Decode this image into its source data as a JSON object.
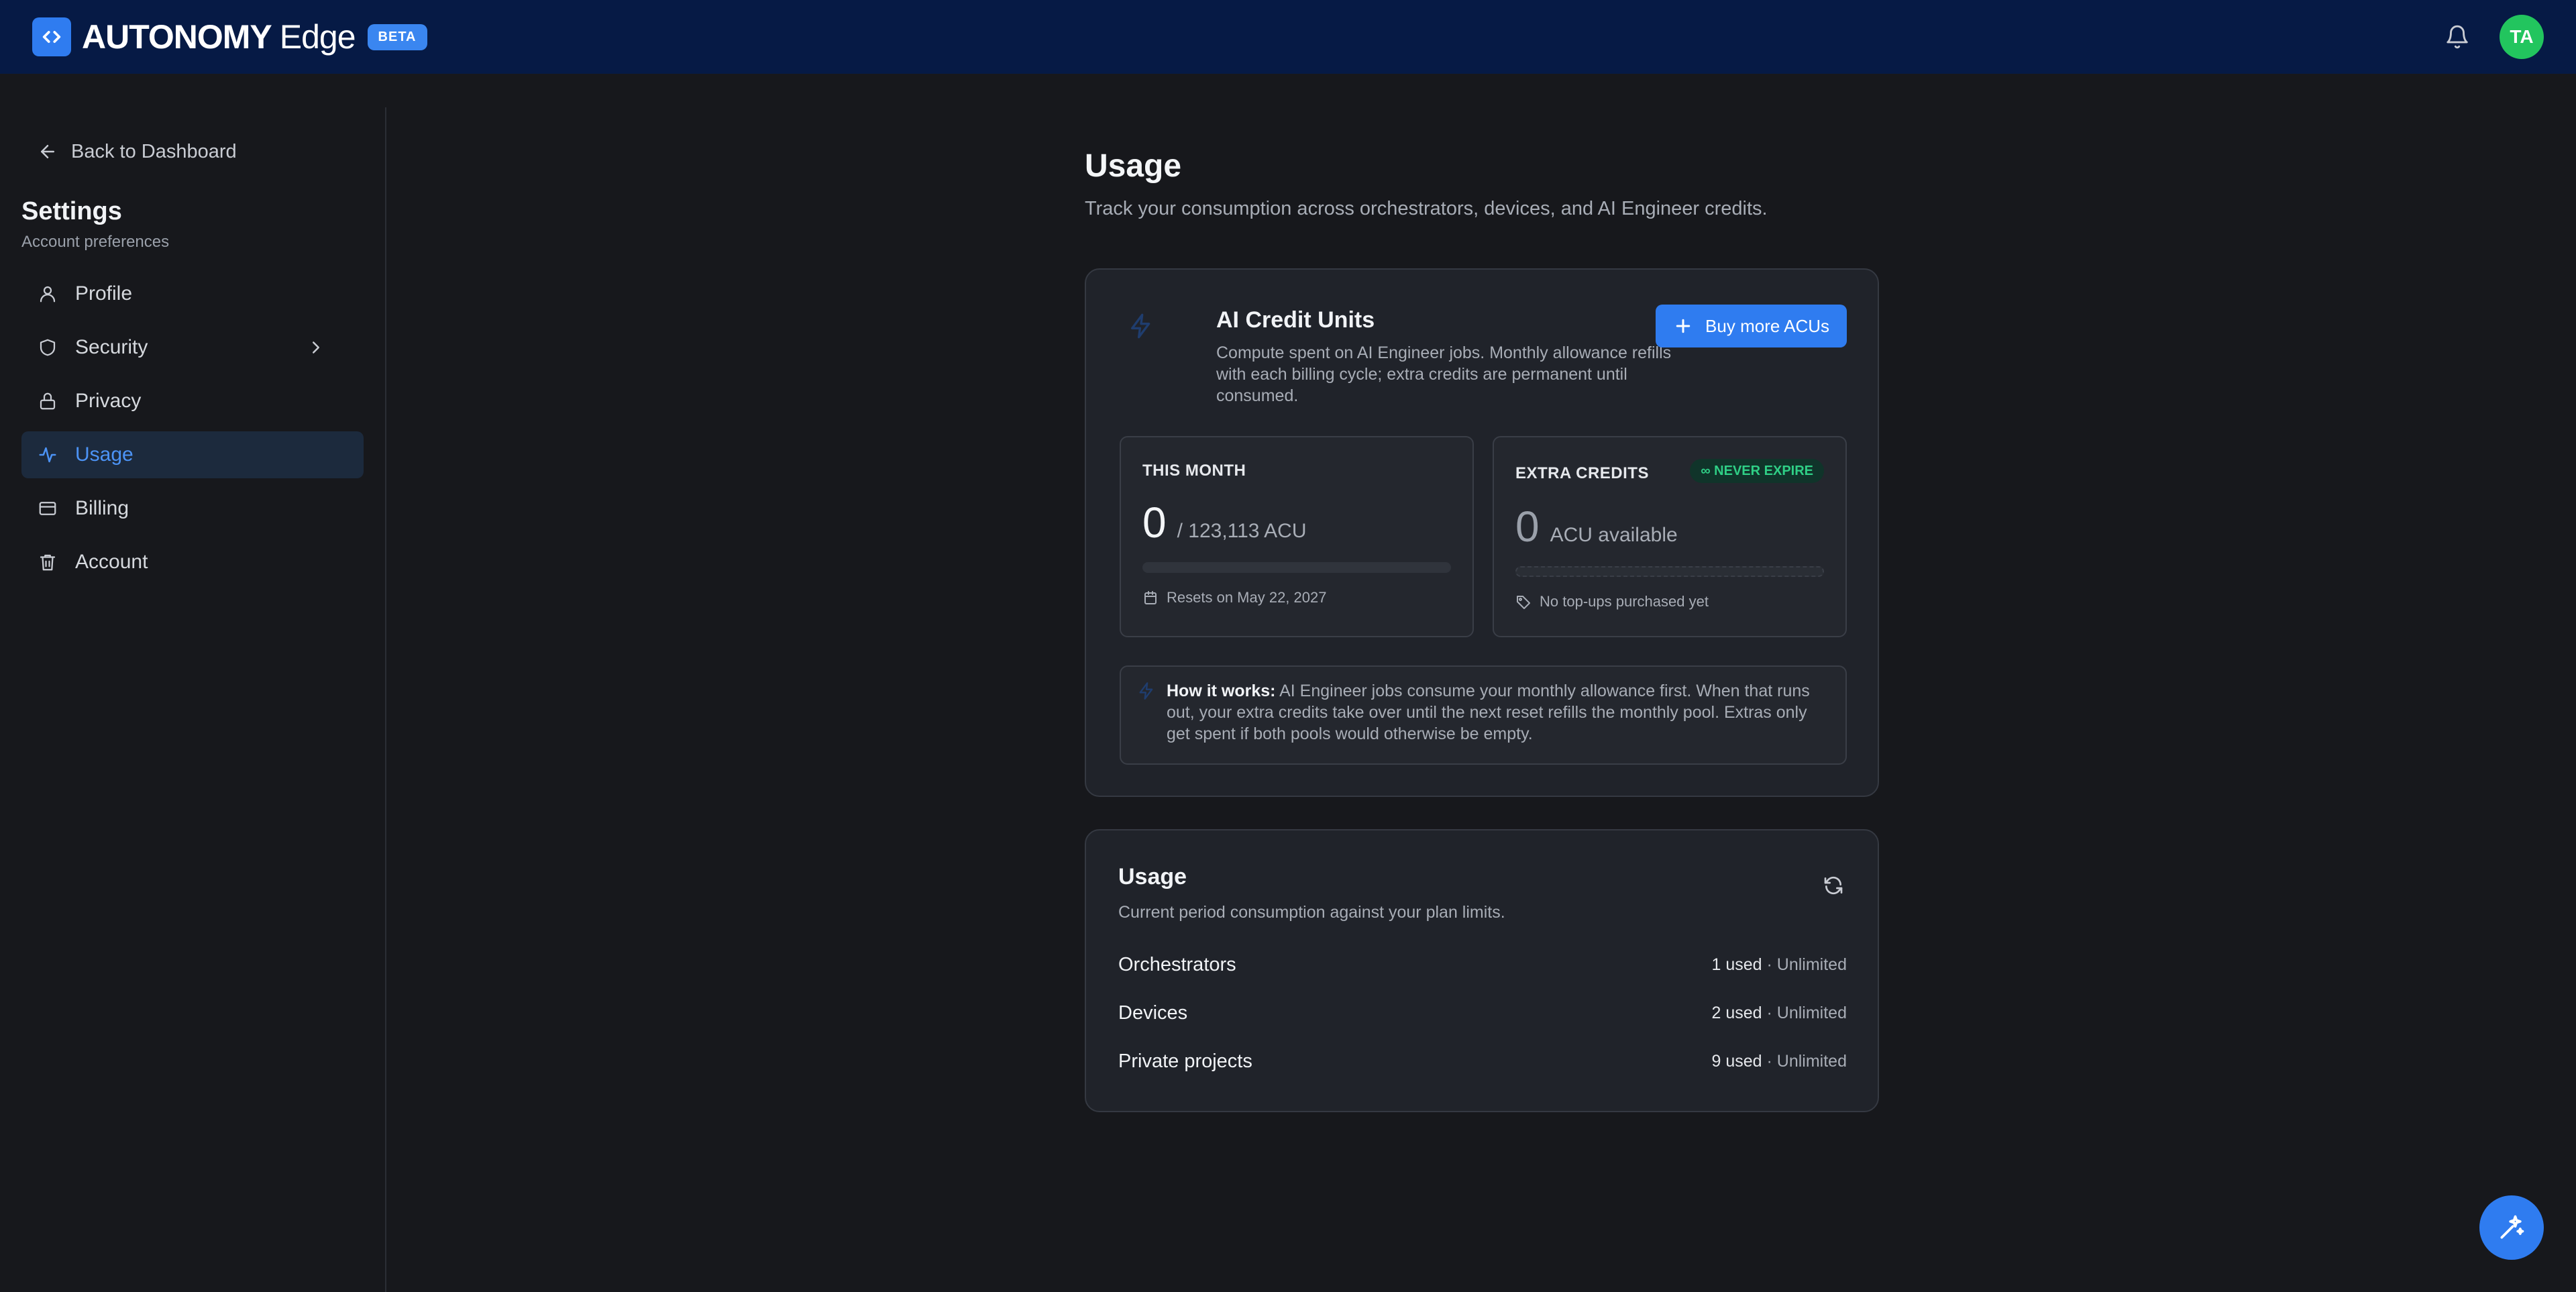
{
  "header": {
    "brand_strong": "AUTONOMY",
    "brand_light": "Edge",
    "badge": "BETA",
    "avatar_initials": "TA",
    "accent_color": "#2f7cf0",
    "background_color": "#061a45"
  },
  "sidebar": {
    "back_label": "Back to Dashboard",
    "title": "Settings",
    "subtitle": "Account preferences",
    "items": [
      {
        "label": "Profile",
        "icon": "user-icon"
      },
      {
        "label": "Security",
        "icon": "shield-icon"
      },
      {
        "label": "Privacy",
        "icon": "lock-icon"
      },
      {
        "label": "Usage",
        "icon": "activity-icon",
        "active": true
      },
      {
        "label": "Billing",
        "icon": "credit-card-icon"
      },
      {
        "label": "Account",
        "icon": "trash-icon"
      }
    ]
  },
  "main": {
    "title": "Usage",
    "subtitle": "Track your consumption across orchestrators, devices, and AI Engineer credits."
  },
  "acu": {
    "title": "AI Credit Units",
    "description": "Compute spent on AI Engineer jobs. Monthly allowance refills with each billing cycle; extra credits are permanent until consumed.",
    "buy_label": "Buy more ACUs",
    "this_month": {
      "label": "THIS MONTH",
      "used": "0",
      "limit": "/ 123,113 ACU",
      "progress": 0,
      "reset": "Resets on May 22, 2027"
    },
    "extra": {
      "label": "EXTRA CREDITS",
      "badge": "∞ NEVER EXPIRE",
      "value": "0",
      "unit": "ACU available",
      "note": "No top-ups purchased yet"
    },
    "how_it_works": {
      "label": "How it works:",
      "text": "AI Engineer jobs consume your monthly allowance first. When that runs out, your extra credits take over until the next reset refills the monthly pool. Extras only get spent if both pools would otherwise be empty."
    }
  },
  "usage": {
    "title": "Usage",
    "subtitle": "Current period consumption against your plan limits.",
    "rows": [
      {
        "label": "Orchestrators",
        "used": "1 used",
        "limit": "· Unlimited"
      },
      {
        "label": "Devices",
        "used": "2 used",
        "limit": "· Unlimited"
      },
      {
        "label": "Private projects",
        "used": "9 used",
        "limit": "· Unlimited"
      }
    ]
  }
}
